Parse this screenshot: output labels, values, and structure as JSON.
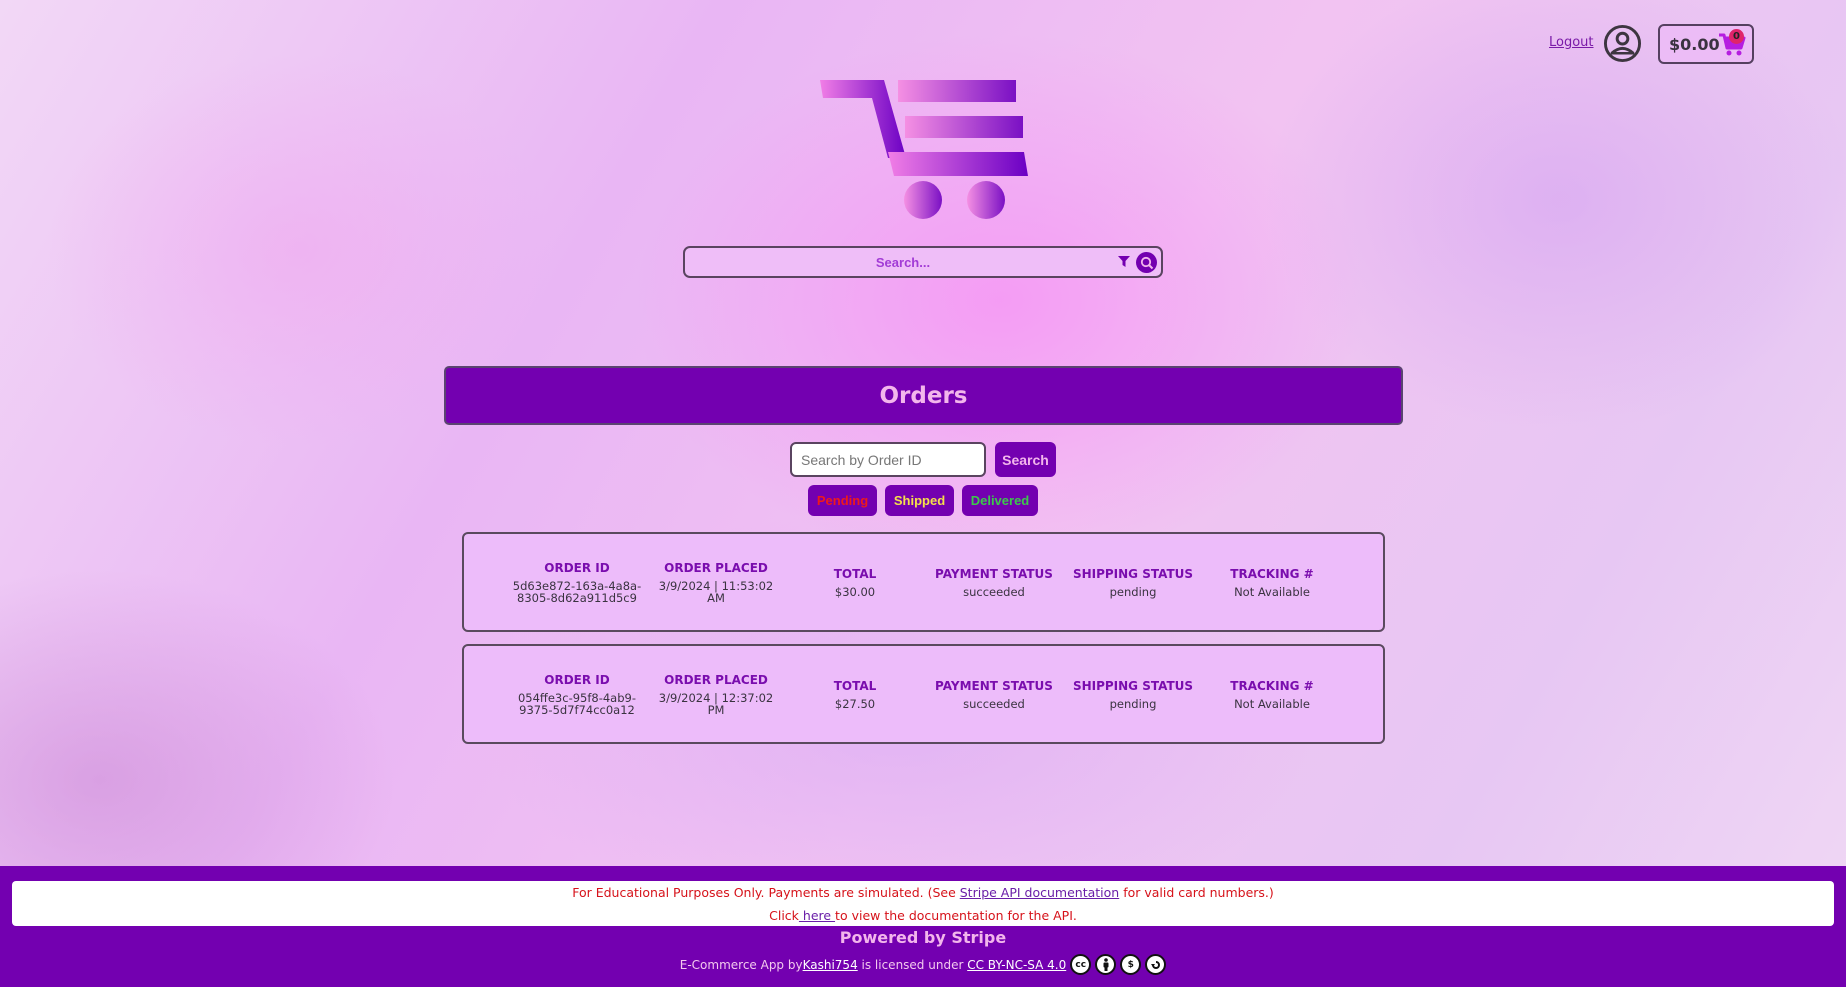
{
  "header": {
    "logout_label": "Logout",
    "cart_total": "$0.00",
    "cart_count": "0"
  },
  "search": {
    "placeholder": "Search..."
  },
  "orders_page": {
    "title": "Orders",
    "order_id_search_placeholder": "Search by Order ID",
    "search_button_label": "Search",
    "filters": [
      {
        "label": "Pending",
        "color": "#ee1a1a"
      },
      {
        "label": "Shipped",
        "color": "#f5e04a"
      },
      {
        "label": "Delivered",
        "color": "#3cc84a"
      }
    ],
    "column_labels": {
      "order_id": "ORDER ID",
      "order_placed": "ORDER PLACED",
      "total": "TOTAL",
      "payment_status": "PAYMENT STATUS",
      "shipping_status": "SHIPPING STATUS",
      "tracking": "TRACKING #"
    },
    "orders": [
      {
        "order_id": "5d63e872-163a-4a8a-8305-8d62a911d5c9",
        "order_placed": "3/9/2024 | 11:53:02 AM",
        "total": "$30.00",
        "payment_status": "succeeded",
        "shipping_status": "pending",
        "tracking": "Not Available"
      },
      {
        "order_id": "054ffe3c-95f8-4ab9-9375-5d7f74cc0a12",
        "order_placed": "3/9/2024 | 12:37:02 PM",
        "total": "$27.50",
        "payment_status": "succeeded",
        "shipping_status": "pending",
        "tracking": "Not Available"
      }
    ]
  },
  "footer": {
    "notice_line1_before": "For Educational Purposes Only. Payments are simulated. (See ",
    "notice_line1_link": "Stripe API documentation",
    "notice_line1_after": " for valid card numbers.)",
    "notice_line2_before": "Click",
    "notice_line2_link": " here ",
    "notice_line2_after": "to view the documentation for the API.",
    "powered_by": "Powered by Stripe",
    "license_before": "E-Commerce App by",
    "license_author": " Kashi754",
    "license_middle": " is licensed under ",
    "license_link": "CC BY-NC-SA 4.0 ",
    "license_icons": [
      "cc-icon",
      "by-icon",
      "nc-icon",
      "sa-icon"
    ]
  },
  "colors": {
    "brand_purple": "#7300b0",
    "accent_pink": "#f3b6ec",
    "card_bg": "#edbcfa"
  }
}
